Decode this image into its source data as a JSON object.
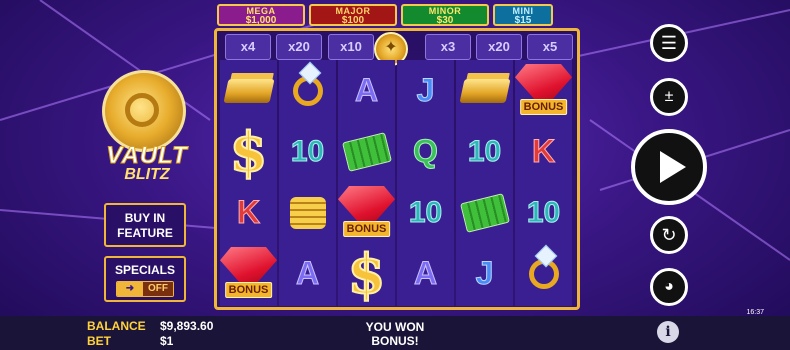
{
  "game": {
    "title_line1": "VAULT",
    "title_line2": "BLITZ"
  },
  "jackpots": [
    {
      "name": "MEGA",
      "value": "$1,000"
    },
    {
      "name": "MAJOR",
      "value": "$100"
    },
    {
      "name": "MINOR",
      "value": "$30"
    },
    {
      "name": "MINI",
      "value": "$15"
    }
  ],
  "multipliers": [
    "x4",
    "x20",
    "x10",
    "x3",
    "x20",
    "x5"
  ],
  "reels": [
    [
      "gold-bars",
      "dollar",
      "k",
      "bonus-gem"
    ],
    [
      "ring",
      "10",
      "coins",
      "a"
    ],
    [
      "a",
      "cash",
      "bonus-gem",
      "dollar"
    ],
    [
      "j",
      "q",
      "10",
      "a"
    ],
    [
      "gold-bars",
      "10",
      "cash",
      "j"
    ],
    [
      "bonus-gem",
      "k",
      "10",
      "ring"
    ]
  ],
  "symbol_text": {
    "a": "A",
    "j": "J",
    "q": "Q",
    "k": "K",
    "10": "10",
    "dollar": "$",
    "bonus": "BONUS"
  },
  "side_buttons": {
    "buy_feature": "BUY IN FEATURE",
    "specials": "SPECIALS",
    "specials_state": "OFF"
  },
  "status": {
    "balance_label": "BALANCE",
    "balance_value": "$9,893.60",
    "bet_label": "BET",
    "bet_value": "$1",
    "win_line1": "YOU WON",
    "win_line2": "BONUS!"
  },
  "clock": "16:37",
  "icons": {
    "menu": "menu-icon",
    "stake": "stake-icon",
    "spin": "play-icon",
    "autoplay": "autoplay-icon",
    "turbo": "speedometer-icon",
    "info": "info-icon"
  }
}
